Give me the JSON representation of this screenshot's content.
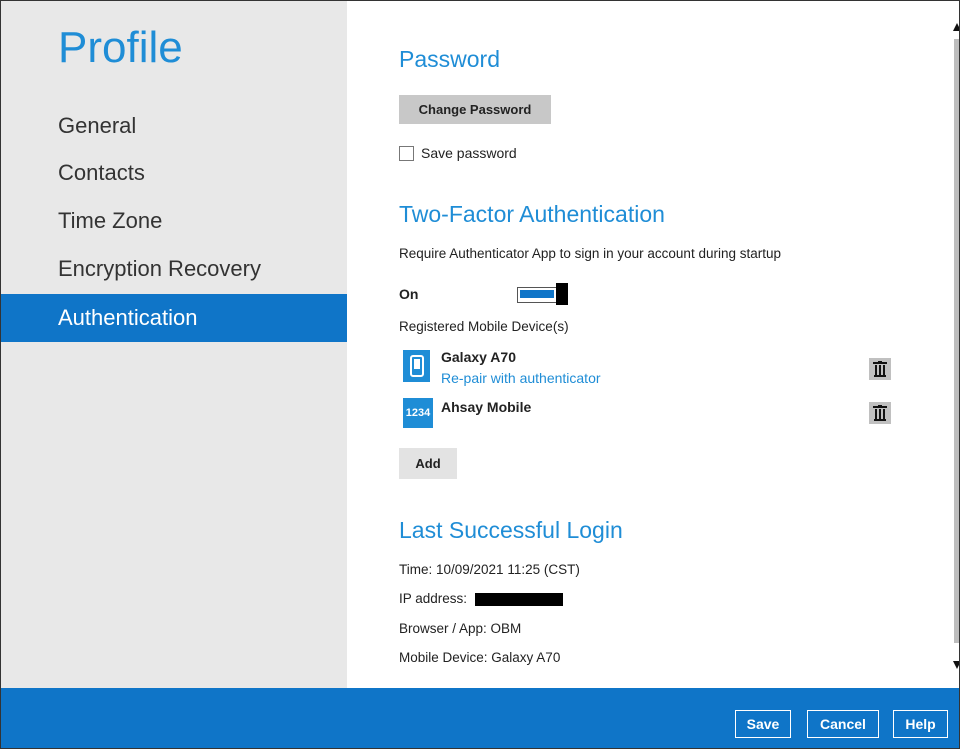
{
  "sidebar": {
    "title": "Profile",
    "items": [
      {
        "label": "General"
      },
      {
        "label": "Contacts"
      },
      {
        "label": "Time Zone"
      },
      {
        "label": "Encryption Recovery"
      },
      {
        "label": "Authentication",
        "active": true
      }
    ]
  },
  "password": {
    "heading": "Password",
    "change_button": "Change Password",
    "save_label": "Save password",
    "save_checked": false
  },
  "two_factor": {
    "heading": "Two-Factor Authentication",
    "description": "Require Authenticator App to sign in your account during startup",
    "toggle_label": "On",
    "toggle_on": true,
    "devices_label": "Registered Mobile Device(s)",
    "devices": [
      {
        "name": "Galaxy A70",
        "link": "Re-pair with authenticator",
        "icon": "mobile-phone-icon"
      },
      {
        "name": "Ahsay Mobile",
        "icon_text": "1234",
        "icon": "otp-code-icon"
      }
    ],
    "add_button": "Add"
  },
  "last_login": {
    "heading": "Last Successful Login",
    "time": "Time: 10/09/2021 11:25 (CST)",
    "ip_label": "IP address:",
    "browser": "Browser / App: OBM",
    "mobile": "Mobile Device: Galaxy A70"
  },
  "footer": {
    "save": "Save",
    "cancel": "Cancel",
    "help": "Help"
  },
  "colors": {
    "accent": "#0f75c8",
    "heading": "#1f8dd6",
    "sidebar_bg": "#e8e8e8",
    "button_gray": "#c8c8c8"
  }
}
